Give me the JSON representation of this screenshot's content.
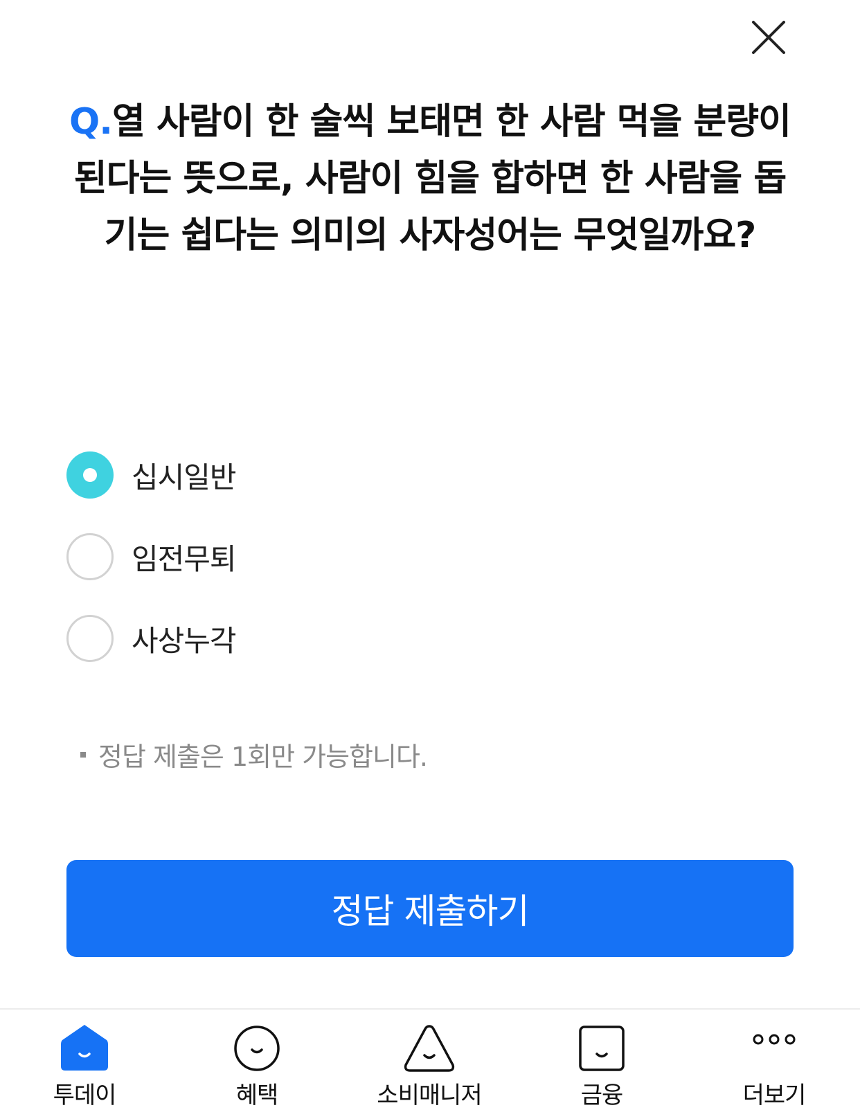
{
  "quiz": {
    "question_prefix": "Q.",
    "question_text": "열 사람이 한 술씩 보태면 한 사람 먹을 분량이 된다는 뜻으로, 사람이 힘을 합하면 한 사람을 돕기는 쉽다는 의미의 사자성어는 무엇일까요?",
    "options": [
      {
        "label": "십시일반",
        "selected": true
      },
      {
        "label": "임전무퇴",
        "selected": false
      },
      {
        "label": "사상누각",
        "selected": false
      }
    ],
    "note": "정답 제출은 1회만 가능합니다.",
    "submit_label": "정답 제출하기"
  },
  "close_icon": "close-icon",
  "colors": {
    "accent_blue": "#1672f5",
    "radio_selected": "#3fd2e0",
    "note_gray": "#8a8a8a"
  },
  "tabbar": {
    "items": [
      {
        "label": "투데이",
        "icon": "home-icon",
        "active": true
      },
      {
        "label": "혜택",
        "icon": "smile-circle-icon",
        "active": false
      },
      {
        "label": "소비매니저",
        "icon": "smile-triangle-icon",
        "active": false
      },
      {
        "label": "금융",
        "icon": "smile-square-icon",
        "active": false
      },
      {
        "label": "더보기",
        "icon": "more-dots-icon",
        "active": false
      }
    ]
  }
}
